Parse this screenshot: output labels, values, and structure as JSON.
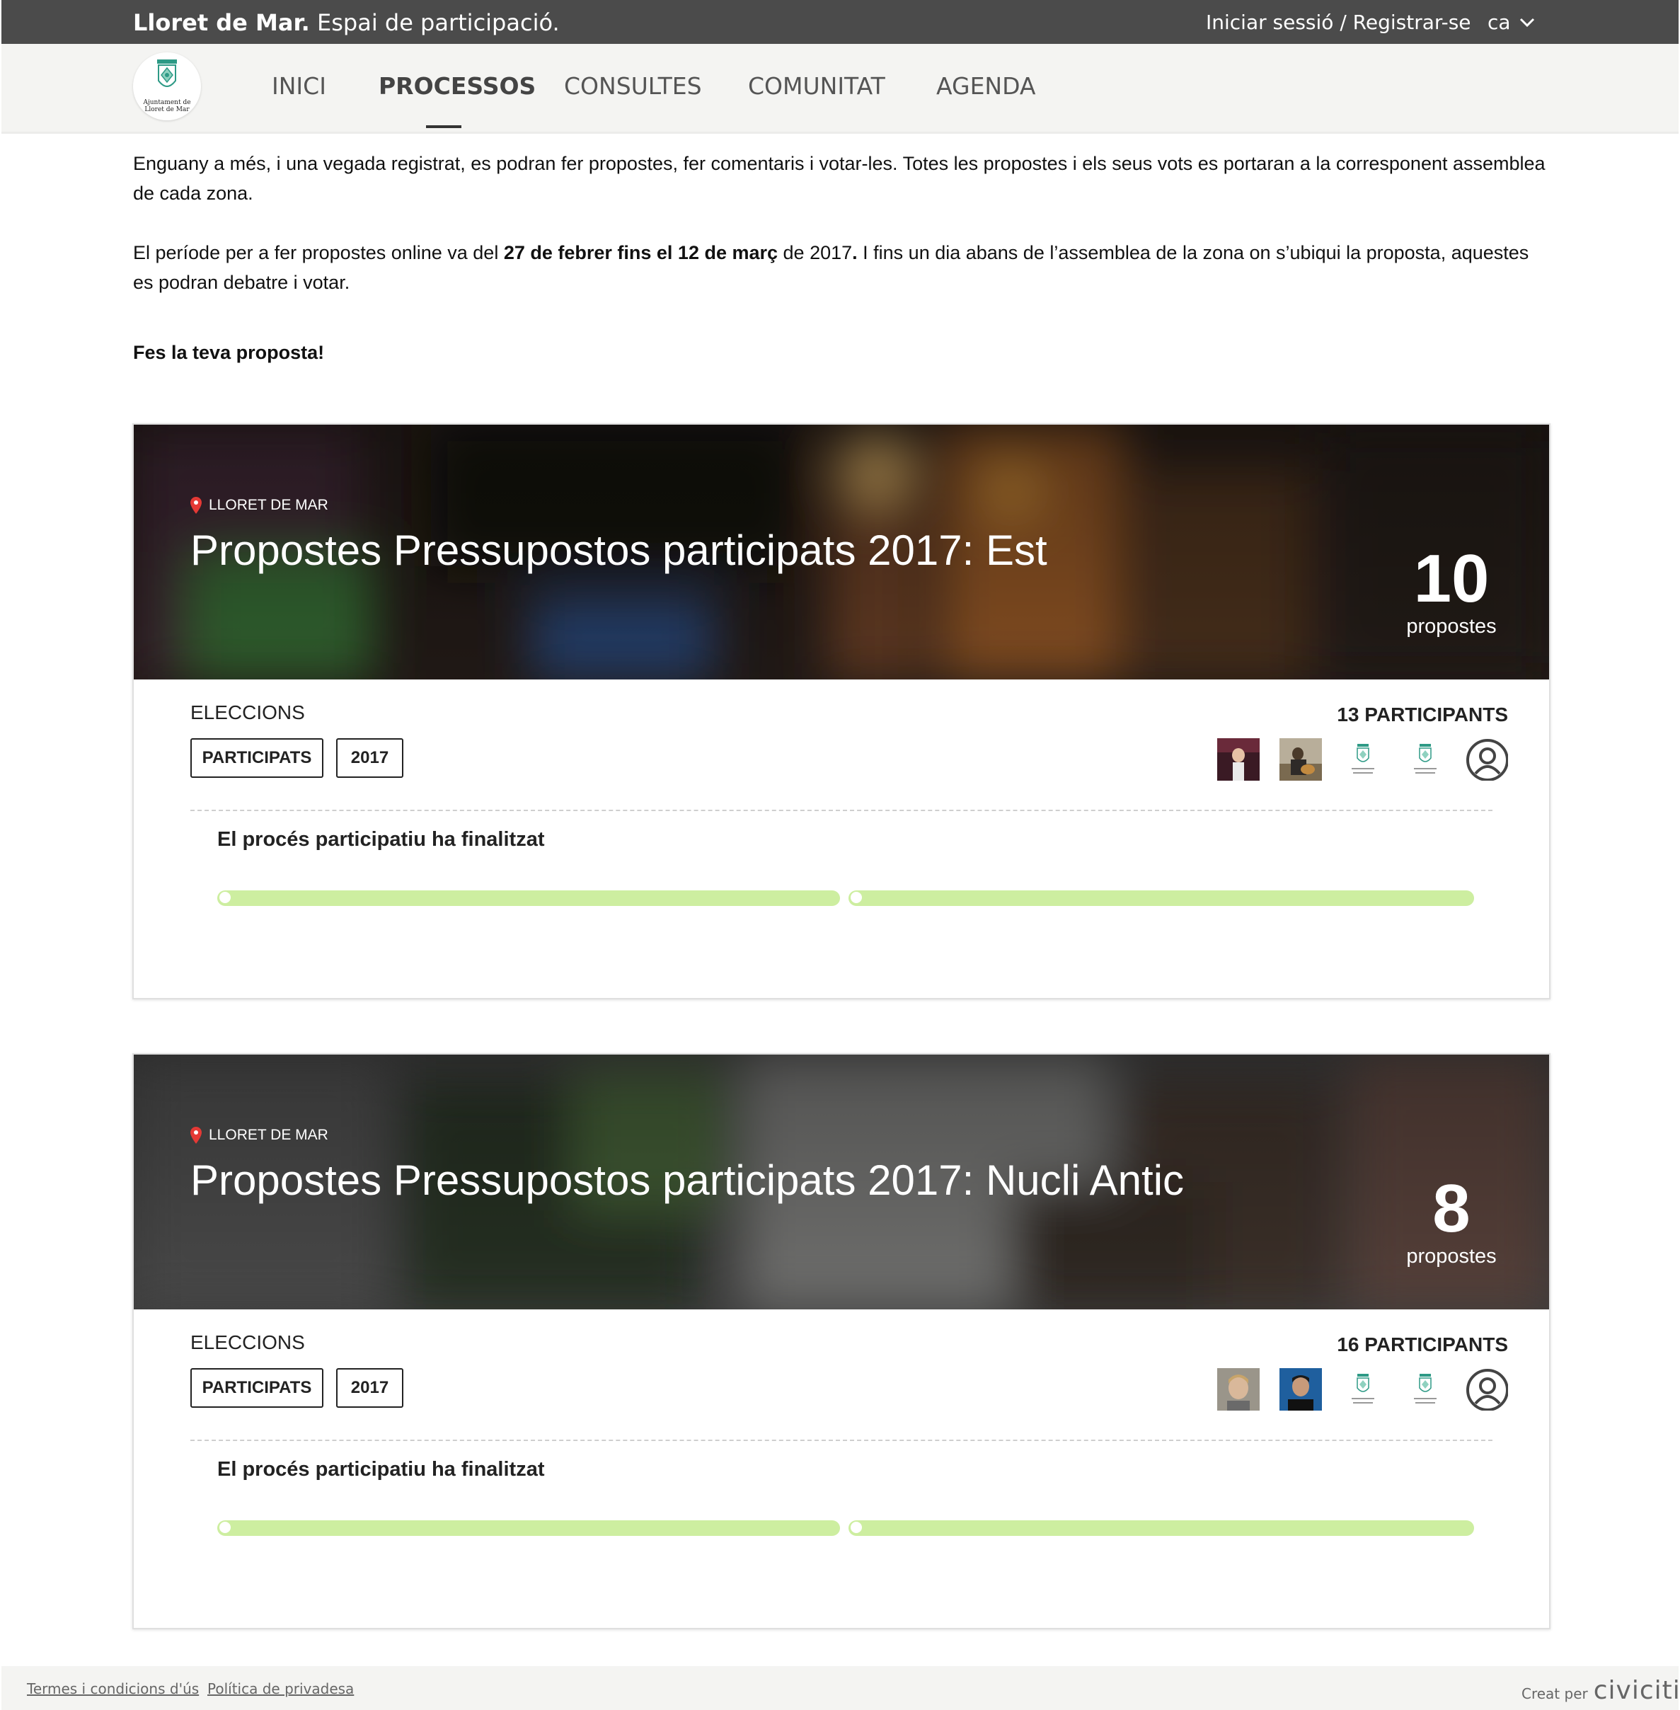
{
  "topbar": {
    "brand_bold": "Lloret de Mar.",
    "brand_rest": "Espai de participació.",
    "login_label": "Iniciar sessió / Registrar-se",
    "language": "ca"
  },
  "nav": {
    "logo_text_line1": "Ajuntament de",
    "logo_text_line2": "Lloret de Mar",
    "items": [
      {
        "label": "INICI"
      },
      {
        "label": "PROCESSOS"
      },
      {
        "label": "CONSULTES"
      },
      {
        "label": "COMUNITAT"
      },
      {
        "label": "AGENDA"
      }
    ],
    "active": "PROCESSOS"
  },
  "intro": {
    "p1": "Enguany a més, i una vegada registrat, es podran fer propostes, fer comentaris i votar-les. Totes les propostes i els seus vots es portaran a la corresponent assemblea de cada zona.",
    "p2_a": "El període per a fer propostes online va del ",
    "p2_bold": "27 de febrer fins el 12 de març",
    "p2_b": " de 2017",
    "p2_bold2": ".",
    "p2_c": " I fins un dia abans de l’assemblea de la zona on s’ubiqui la proposta, aquestes es podran debatre i votar.",
    "cta": "Fes la teva proposta!"
  },
  "cards": [
    {
      "location": "LLORET DE MAR",
      "title": "Propostes Pressupostos participats 2017: Est",
      "count": "10",
      "count_label": "propostes",
      "category": "ELECCIONS",
      "tags": [
        "PARTICIPATS",
        "2017"
      ],
      "participants": "13 PARTICIPANTS",
      "status": "El procés participatiu ha finalitzat",
      "phases_progress": [
        1,
        1
      ]
    },
    {
      "location": "LLORET DE MAR",
      "title": "Propostes Pressupostos participats 2017: Nucli Antic",
      "count": "8",
      "count_label": "propostes",
      "category": "ELECCIONS",
      "tags": [
        "PARTICIPATS",
        "2017"
      ],
      "participants": "16 PARTICIPANTS",
      "status": "El procés participatiu ha finalitzat",
      "phases_progress": [
        1,
        1
      ]
    }
  ],
  "footer": {
    "terms": "Termes i condicions d'ús",
    "privacy": "Política de privadesa",
    "credit_label": "Creat per",
    "credit_brand": "civiciti"
  },
  "colors": {
    "topbar": "#4b4b4b",
    "navbar": "#f4f4f2",
    "progress": "#cdeea0",
    "location_pin": "#e53935"
  }
}
